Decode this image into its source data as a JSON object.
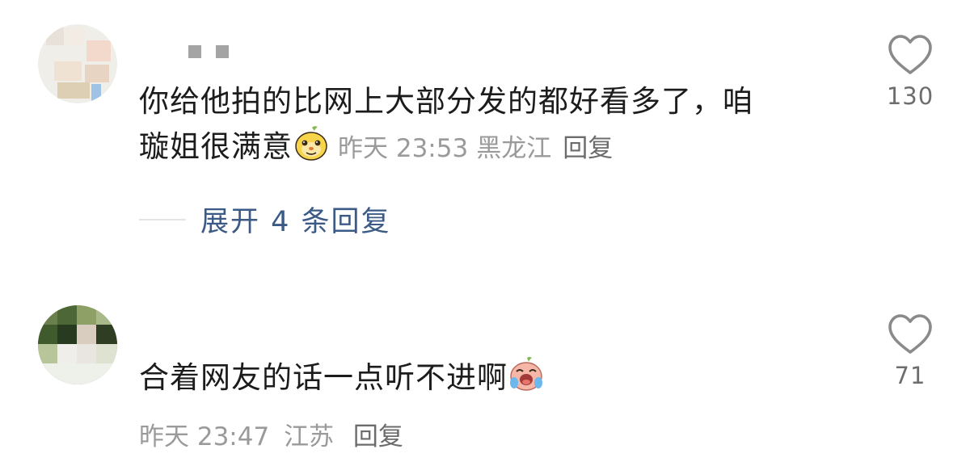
{
  "comments": [
    {
      "username_masked": "■ ■",
      "content_line1": "你给他拍的比网上大部分发的都好看多了，咱",
      "content_line2": "璇姐很满意",
      "emoji": "smug-face-emoji",
      "time": "昨天 23:53",
      "location": "黑龙江",
      "reply_label": "回复",
      "likes": "130",
      "expand_label": "展开 4 条回复"
    },
    {
      "content": "合着网友的话一点听不进啊",
      "emoji": "crying-laughing-emoji",
      "time": "昨天 23:47",
      "location": "江苏",
      "reply_label": "回复",
      "likes": "71"
    }
  ],
  "colors": {
    "text": "#1c1c1c",
    "meta": "#9a9a9a",
    "link": "#3b5a86",
    "icon": "#8a8a8a"
  },
  "icons": [
    "heart-outline-icon"
  ]
}
